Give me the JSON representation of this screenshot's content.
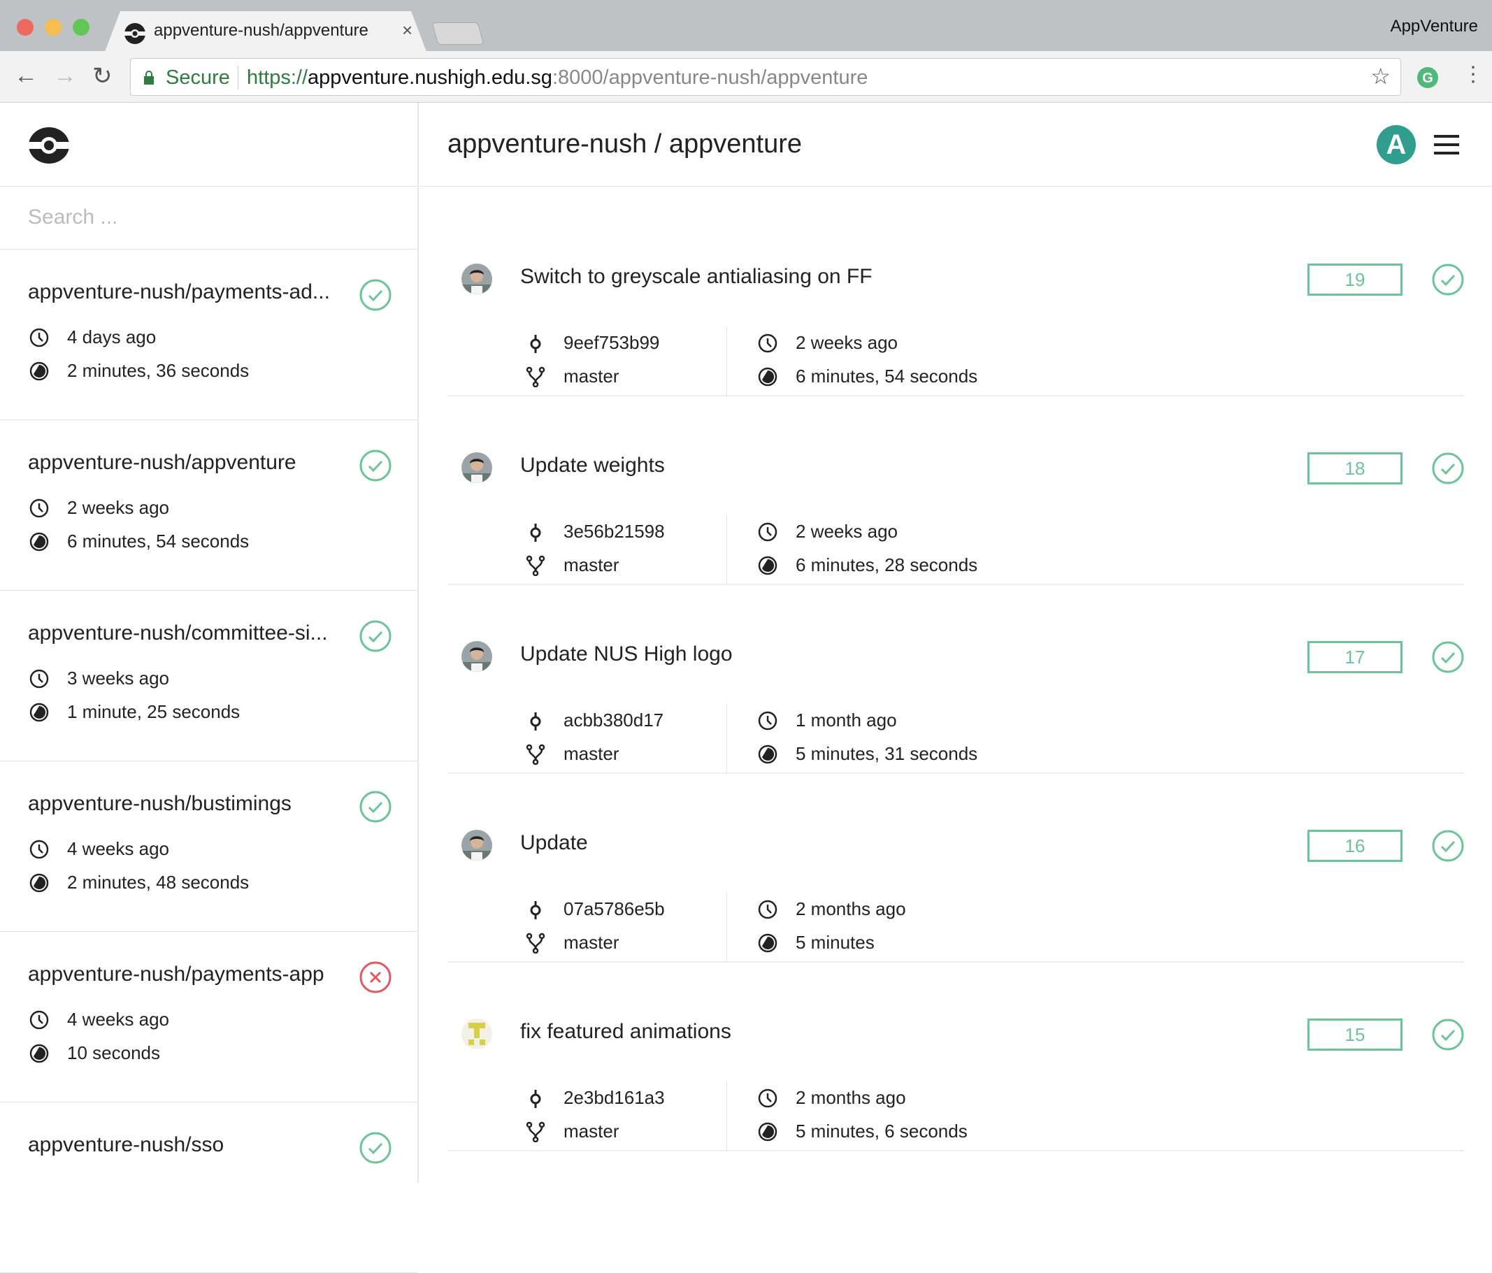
{
  "browser": {
    "tab_title": "appventure-nush/appventure",
    "profile_name": "AppVenture",
    "secure_label": "Secure",
    "url_scheme": "https://",
    "url_host": "appventure.nushigh.edu.sg",
    "url_rest": ":8000/appventure-nush/appventure"
  },
  "sidebar": {
    "search_placeholder": "Search ...",
    "repos": [
      {
        "name": "appventure-nush/payments-ad...",
        "time": "4 days ago",
        "duration": "2 minutes, 36 seconds",
        "status": "success"
      },
      {
        "name": "appventure-nush/appventure",
        "time": "2 weeks ago",
        "duration": "6 minutes, 54 seconds",
        "status": "success"
      },
      {
        "name": "appventure-nush/committee-si...",
        "time": "3 weeks ago",
        "duration": "1 minute, 25 seconds",
        "status": "success"
      },
      {
        "name": "appventure-nush/bustimings",
        "time": "4 weeks ago",
        "duration": "2 minutes, 48 seconds",
        "status": "success"
      },
      {
        "name": "appventure-nush/payments-app",
        "time": "4 weeks ago",
        "duration": "10 seconds",
        "status": "failure"
      },
      {
        "name": "appventure-nush/sso",
        "time": "",
        "duration": "",
        "status": "success"
      }
    ]
  },
  "main": {
    "title": "appventure-nush / appventure",
    "user_initial": "A",
    "builds": [
      {
        "title": "Switch to greyscale antialiasing on FF",
        "number": "19",
        "commit": "9eef753b99",
        "branch": "master",
        "time": "2 weeks ago",
        "duration": "6 minutes, 54 seconds",
        "status": "success"
      },
      {
        "title": "Update weights",
        "number": "18",
        "commit": "3e56b21598",
        "branch": "master",
        "time": "2 weeks ago",
        "duration": "6 minutes, 28 seconds",
        "status": "success"
      },
      {
        "title": "Update NUS High logo",
        "number": "17",
        "commit": "acbb380d17",
        "branch": "master",
        "time": "1 month ago",
        "duration": "5 minutes, 31 seconds",
        "status": "success"
      },
      {
        "title": "Update",
        "number": "16",
        "commit": "07a5786e5b",
        "branch": "master",
        "time": "2 months ago",
        "duration": "5 minutes",
        "status": "success"
      },
      {
        "title": "fix featured animations",
        "number": "15",
        "commit": "2e3bd161a3",
        "branch": "master",
        "time": "2 months ago",
        "duration": "5 minutes, 6 seconds",
        "status": "success"
      }
    ]
  },
  "colors": {
    "success": "#6cc49a",
    "failure": "#e05a63",
    "secure": "#2d7d3f"
  }
}
